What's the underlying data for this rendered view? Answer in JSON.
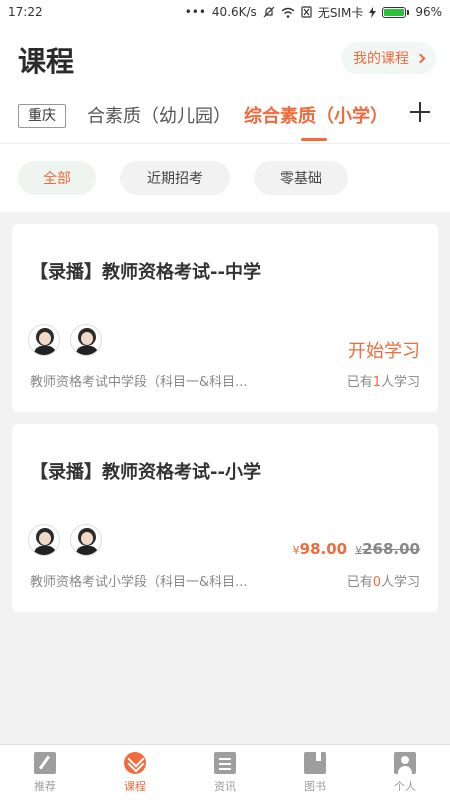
{
  "status_bar": {
    "time": "17:22",
    "network_speed": "40.6K/s",
    "sim_text": "无SIM卡",
    "battery": "96%",
    "battery_level": 0.96
  },
  "header": {
    "title": "课程",
    "my_course_label": "我的课程"
  },
  "tabs": {
    "city": "重庆",
    "prev_tab_partial": "合素质（幼儿园）",
    "active_tab": "综合素质（小学）"
  },
  "filters": {
    "items": [
      "全部",
      "近期招考",
      "零基础"
    ],
    "selected": "全部"
  },
  "courses": [
    {
      "title": "【录播】教师资格考试--中学",
      "description": "教师资格考试中学段（科目一&科目...",
      "action_label": "开始学习",
      "count_prefix": "已有",
      "count": "1",
      "count_suffix": "人学习"
    },
    {
      "title": "【录播】教师资格考试--小学",
      "description": "教师资格考试小学段（科目一&科目...",
      "currency": "¥",
      "price": "98.00",
      "original_price": "268.00",
      "count_prefix": "已有",
      "count": "0",
      "count_suffix": "人学习"
    }
  ],
  "tabbar": {
    "items": [
      "推荐",
      "课程",
      "资讯",
      "图书",
      "个人"
    ],
    "active": "课程"
  },
  "colors": {
    "accent": "#f06a3c",
    "chip_active_bg": "#eef5f1",
    "chip_bg": "#f2f2f2",
    "page_bg": "#f2f2f2"
  }
}
